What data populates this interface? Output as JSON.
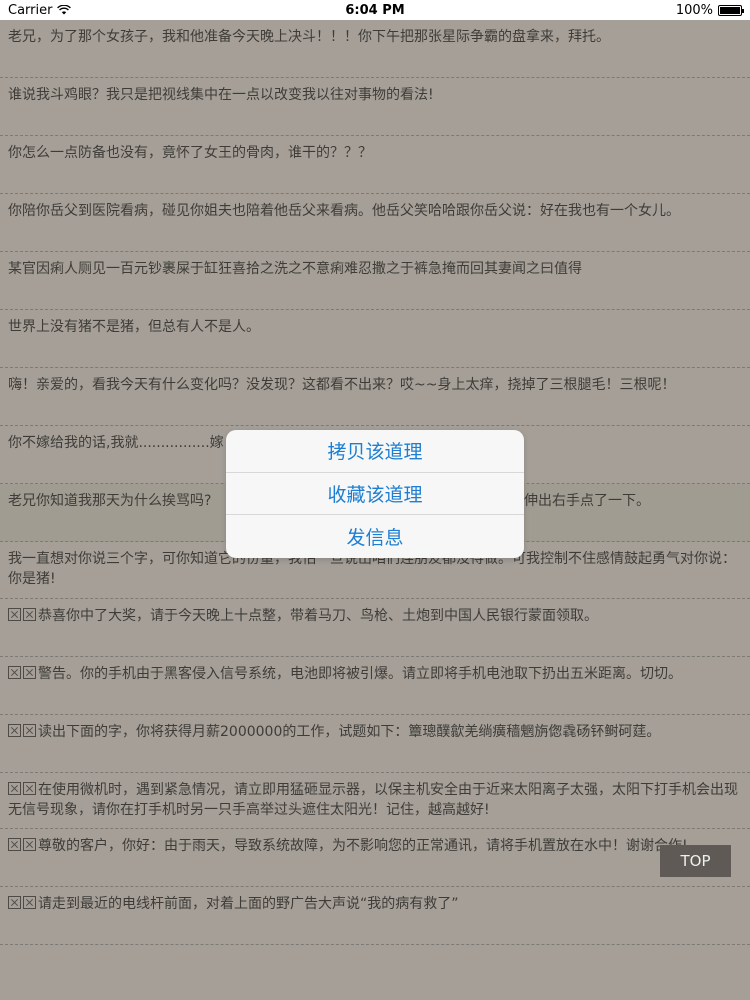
{
  "status": {
    "carrier": "Carrier",
    "time": "6:04 PM",
    "battery": "100%"
  },
  "rows": [
    "老兄，为了那个女孩子，我和他准备今天晚上决斗！！！你下午把那张星际争霸的盘拿来，拜托。",
    "谁说我斗鸡眼？我只是把视线集中在一点以改变我以往对事物的看法!",
    "你怎么一点防备也没有，竟怀了女王的骨肉，谁干的？？？",
    "你陪你岳父到医院看病，碰见你姐夫也陪着他岳父来看病。他岳父笑哈哈跟你岳父说：好在我也有一个女儿。",
    "某官因痢人厕见一百元钞裹屎于缸狂喜拾之洗之不意痢难忍撒之于裤急掩而回其妻闻之曰值得",
    "世界上没有猪不是猪，但总有人不是人。",
    "嗨！亲爱的，看我今天有什么变化吗？没发现？这都看不出来？哎~~身上太痒，挠掉了三根腿毛！三根呢！",
    "你不嫁给我的话,我就................嫁",
    "老兄你知道我那天为什么挨骂吗?",
    "我一直想对你说三个字，可你知道它的份量，我怕一旦说出咱们连朋友都没得做。可我控制不住感情鼓起勇气对你说：你是猪!",
    "恭喜你中了大奖，请于今天晚上十点整，带着马刀、鸟枪、土炮到中国人民银行蒙面领取。",
    "警告。你的手机由于黑客侵入信号系统，电池即将被引爆。请立即将手机电池取下扔出五米距离。切切。",
    "读出下面的字，你将获得月薪2000000的工作，试题如下：簟璁醭歙羌绱癀穑魍旃偬毳砀钚鲥砢莛。",
    "在使用微机时，遇到紧急情况，请立即用猛砸显示器，以保主机安全由于近来太阳离子太强，太阳下打手机会出现无信号现象，请你在打手机时另一只手高举过头遮住太阳光！记住，越高越好!",
    "尊敬的客户，你好：由于雨天，导致系统故障，为不影响您的正常通讯，请将手机置放在水中！谢谢合作!",
    "请走到最近的电线杆前面，对着上面的野广告大声说“我的病有救了”"
  ],
  "row9_tail": "伸出右手点了一下。",
  "action_sheet": {
    "copy": "拷贝该道理",
    "favorite": "收藏该道理",
    "message": "发信息"
  },
  "top_button": "TOP",
  "icons": {
    "row_prefix": "boxed-x-icon",
    "wifi": "wifi-icon",
    "battery": "battery-icon"
  }
}
